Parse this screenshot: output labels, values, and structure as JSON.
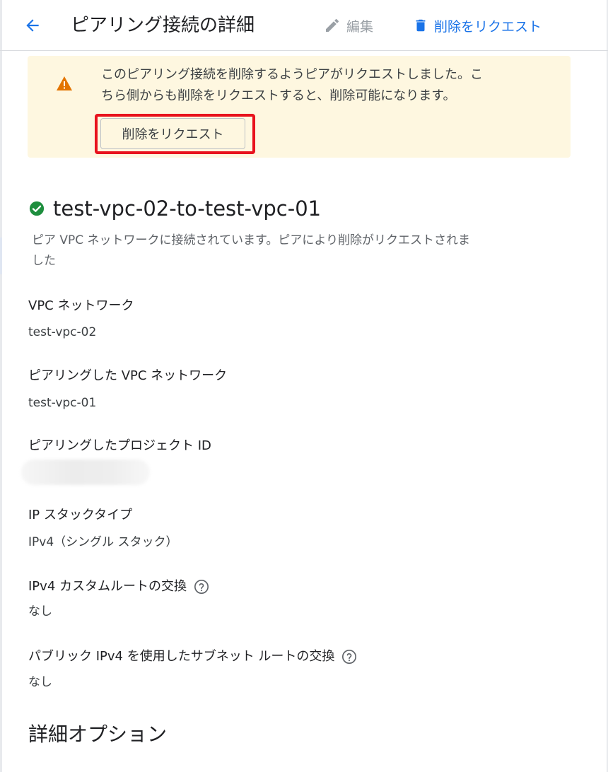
{
  "header": {
    "title": "ピアリング接続の詳細",
    "edit_label": "編集",
    "delete_label": "削除をリクエスト"
  },
  "banner": {
    "message_line1": "このピアリング接続を削除するようピアがリクエストしました。こ",
    "message_line2": "ちら側からも削除をリクエストすると、削除可能になります。",
    "button_label": "削除をリクエスト"
  },
  "resource": {
    "name": "test-vpc-02-to-test-vpc-01",
    "status_line1": "ピア VPC ネットワークに接続されています。ピアにより削除がリクエストされま",
    "status_line2": "した"
  },
  "fields": {
    "vpc_network": {
      "label": "VPC ネットワーク",
      "value": "test-vpc-02"
    },
    "peered_vpc_network": {
      "label": "ピアリングした VPC ネットワーク",
      "value": "test-vpc-01"
    },
    "peered_project_id": {
      "label": "ピアリングしたプロジェクト ID"
    },
    "ip_stack_type": {
      "label": "IP スタックタイプ",
      "value": "IPv4（シングル スタック）"
    },
    "ipv4_custom_routes": {
      "label": "IPv4 カスタムルートの交換",
      "value": "なし"
    },
    "public_ipv4_subnet_routes": {
      "label": "パブリック IPv4 を使用したサブネット ルートの交換",
      "value": "なし"
    }
  },
  "section": {
    "advanced_title": "詳細オプション"
  },
  "colors": {
    "accent": "#1a73e8",
    "warning": "#e37400",
    "success": "#1e8e3e",
    "banner_bg": "#fef7e0",
    "highlight": "#e8121d"
  },
  "icons": {
    "back": "arrow-back-icon",
    "edit": "pencil-icon",
    "delete": "trash-icon",
    "warning": "warning-icon",
    "status": "check-circle-icon",
    "help": "help-icon"
  }
}
